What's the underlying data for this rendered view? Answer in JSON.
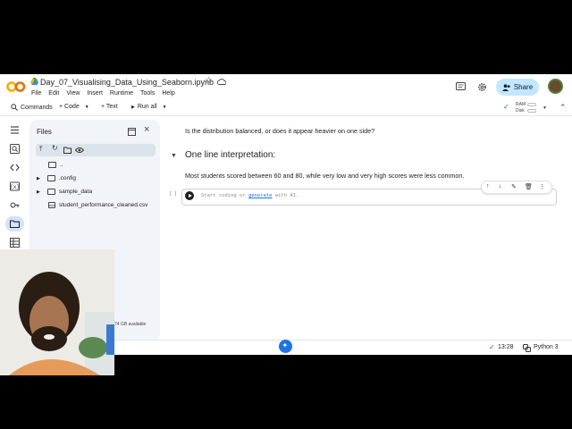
{
  "notebook": {
    "title": "Day_07_Visualising_Data_Using_Seaborn.ipynb"
  },
  "menu": [
    "File",
    "Edit",
    "View",
    "Insert",
    "Runtime",
    "Tools",
    "Help"
  ],
  "header": {
    "share_label": "Share"
  },
  "toolbar": {
    "commands_label": "Commands",
    "code_label": "+ Code",
    "text_label": "+ Text",
    "run_all_label": "Run all",
    "ram_label": "RAM",
    "disk_label": "Disk"
  },
  "files_panel": {
    "title": "Files",
    "items": [
      {
        "name": "..",
        "kind": "folder"
      },
      {
        "name": ".config",
        "kind": "folder"
      },
      {
        "name": "sample_data",
        "kind": "folder"
      },
      {
        "name": "student_performance_cleaned.csv",
        "kind": "csv"
      }
    ],
    "disk_available": "74 GB available"
  },
  "content": {
    "question": "Is the distribution balanced, or does it appear heavier on one side?",
    "heading": "One line interpretation:",
    "interpretation": "Most students scored between 60 and 80, while very low and very high scores were less common.",
    "code_placeholder_prefix": "Start coding or ",
    "code_placeholder_link": "generate",
    "code_placeholder_suffix": " with AI.",
    "cell_brackets": "[ ]"
  },
  "status": {
    "time": "13:28",
    "kernel": "Python 3"
  },
  "colors": {
    "accent": "#1a73e8",
    "share_bg": "#c2e7ff",
    "panel_bg": "#f1f4f9"
  }
}
